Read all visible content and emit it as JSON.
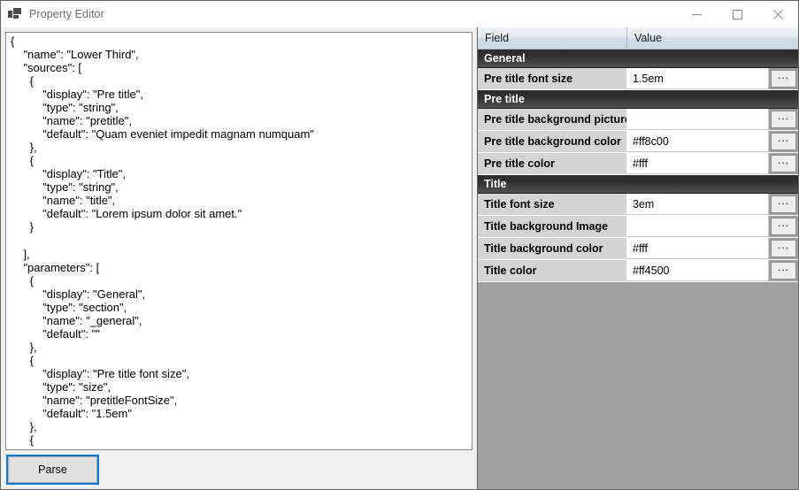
{
  "window": {
    "title": "Property Editor",
    "icon": "app-squares-icon",
    "controls": {
      "minimize": "minimize-icon",
      "maximize": "maximize-icon",
      "close": "close-icon"
    }
  },
  "left_pane": {
    "json_editor": {
      "value": "{\n    \"name\": \"Lower Third\",\n    \"sources\": [\n      {\n          \"display\": \"Pre title\",\n          \"type\": \"string\",\n          \"name\": \"pretitle\",\n          \"default\": \"Quam eveniet impedit magnam numquam\"\n      },\n      {\n          \"display\": \"Title\",\n          \"type\": \"string\",\n          \"name\": \"title\",\n          \"default\": \"Lorem ipsum dolor sit amet.\"\n      }\n\n    ],\n    \"parameters\": [\n      {\n          \"display\": \"General\",\n          \"type\": \"section\",\n          \"name\": \"_general\",\n          \"default\": \"\"\n      },\n      {\n          \"display\": \"Pre title font size\",\n          \"type\": \"size\",\n          \"name\": \"pretitleFontSize\",\n          \"default\": \"1.5em\"\n      },\n      {"
    },
    "parse_button": {
      "label": "Parse"
    }
  },
  "property_grid": {
    "columns": {
      "field": "Field",
      "value": "Value"
    },
    "ellipsis_label": "...",
    "rows": [
      {
        "kind": "section",
        "label": "General"
      },
      {
        "kind": "property",
        "label": "Pre title font size",
        "value": "1.5em"
      },
      {
        "kind": "section",
        "label": "Pre title"
      },
      {
        "kind": "property",
        "label": "Pre title background picture",
        "value": ""
      },
      {
        "kind": "property",
        "label": "Pre title background color",
        "value": "#ff8c00"
      },
      {
        "kind": "property",
        "label": "Pre title color",
        "value": "#fff"
      },
      {
        "kind": "section",
        "label": "Title"
      },
      {
        "kind": "property",
        "label": "Title font size",
        "value": "3em"
      },
      {
        "kind": "property",
        "label": "Title background Image",
        "value": ""
      },
      {
        "kind": "property",
        "label": "Title background color",
        "value": "#fff"
      },
      {
        "kind": "property",
        "label": "Title color",
        "value": "#ff4500"
      }
    ]
  },
  "colors": {
    "accent_focus": "#0078d7",
    "section_header_bg": "#2c2c2c",
    "field_cell_bg": "#d4d4d4",
    "grid_empty_bg": "#a0a0a0"
  }
}
